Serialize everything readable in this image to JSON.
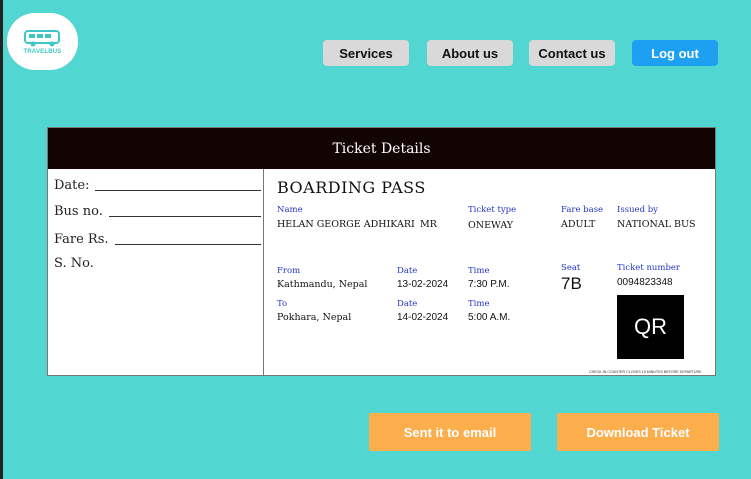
{
  "logo": {
    "text": "TRAVELBUS"
  },
  "nav": {
    "services": "Services",
    "about": "About us",
    "contact": "Contact us",
    "logout": "Log out"
  },
  "ticket": {
    "header": "Ticket Details",
    "stub": {
      "date_label": "Date:",
      "bus_label": "Bus no.",
      "fare_label": "Fare Rs.",
      "sno_label": "S. No."
    },
    "title": "BOARDING PASS",
    "name_label": "Name",
    "name_value": "HELAN GEORGE ADHIKARI",
    "title_value": "MR",
    "ticket_type_label": "Ticket type",
    "ticket_type_value": "ONEWAY",
    "fare_base_label": "Fare base",
    "fare_base_value": "ADULT",
    "issued_by_label": "Issued by",
    "issued_by_value": "NATIONAL BUS",
    "from_label": "From",
    "from_value": "Kathmandu, Nepal",
    "from_date_label": "Date",
    "from_date_value": "13-02-2024",
    "from_time_label": "Time",
    "from_time_value": "7:30 P.M.",
    "seat_label": "Seat",
    "seat_value": "7B",
    "ticket_number_label": "Ticket number",
    "ticket_number_value": "0094823348",
    "to_label": "To",
    "to_value": "Pokhara, Nepal",
    "to_date_label": "Date",
    "to_date_value": "14-02-2024",
    "to_time_label": "Time",
    "to_time_value": "5:00 A.M.",
    "qr_text": "QR",
    "fine_print": "CHECK-IN COUNTER CLOSES 15 MINUTES BEFORE DEPARTURE"
  },
  "actions": {
    "email": "Sent it to email",
    "download": "Download Ticket"
  }
}
